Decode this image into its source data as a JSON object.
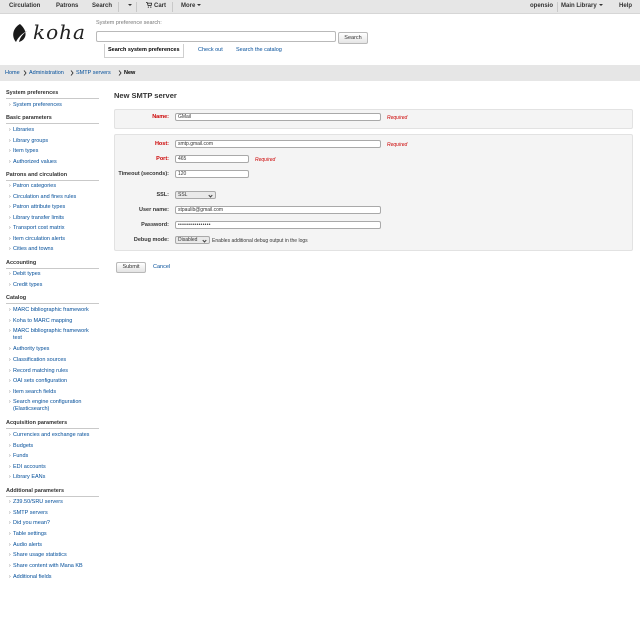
{
  "topnav": {
    "left": [
      "Circulation",
      "Patrons",
      "Search",
      "",
      "Cart",
      "More"
    ],
    "user": "opensio",
    "library": "Main Library",
    "help": "Help"
  },
  "header": {
    "logo_text": "koha",
    "search_label": "System preference search:",
    "search_value": "",
    "search_button": "Search",
    "tabs": [
      "Search system preferences",
      "Check out",
      "Search the catalog"
    ]
  },
  "breadcrumbs": [
    "Home",
    "Administration",
    "SMTP servers",
    "New"
  ],
  "sidebar": {
    "sections": [
      {
        "title": "System preferences",
        "items": [
          "System preferences"
        ]
      },
      {
        "title": "Basic parameters",
        "items": [
          "Libraries",
          "Library groups",
          "Item types",
          "Authorized values"
        ]
      },
      {
        "title": "Patrons and circulation",
        "items": [
          "Patron categories",
          "Circulation and fines rules",
          "Patron attribute types",
          "Library transfer limits",
          "Transport cost matrix",
          "Item circulation alerts",
          "Cities and towns"
        ]
      },
      {
        "title": "Accounting",
        "items": [
          "Debit types",
          "Credit types"
        ]
      },
      {
        "title": "Catalog",
        "items": [
          "MARC bibliographic framework",
          "Koha to MARC mapping",
          "MARC bibliographic framework test",
          "Authority types",
          "Classification sources",
          "Record matching rules",
          "OAI sets configuration",
          "Item search fields",
          "Search engine configuration (Elasticsearch)"
        ]
      },
      {
        "title": "Acquisition parameters",
        "items": [
          "Currencies and exchange rates",
          "Budgets",
          "Funds",
          "EDI accounts",
          "Library EANs"
        ]
      },
      {
        "title": "Additional parameters",
        "items": [
          "Z39.50/SRU servers",
          "SMTP servers",
          "Did you mean?",
          "Table settings",
          "Audio alerts",
          "Share usage statistics",
          "Share content with Mana KB",
          "Additional fields"
        ]
      }
    ]
  },
  "form": {
    "title": "New SMTP server",
    "name_label": "Name:",
    "name_value": "GMail",
    "required_text": "Required",
    "host_label": "Host:",
    "host_value": "smtp.gmail.com",
    "port_label": "Port:",
    "port_value": "465",
    "timeout_label": "Timeout (seconds):",
    "timeout_value": "120",
    "ssl_label": "SSL:",
    "ssl_value": "SSL",
    "user_label": "User name:",
    "user_value": "stpaulib@gmail.com",
    "password_label": "Password:",
    "password_value": "••••••••••••••••",
    "debug_label": "Debug mode:",
    "debug_value": "Disabled",
    "debug_hint": "Enables additional debug output in the logs",
    "submit": "Submit",
    "cancel": "Cancel"
  },
  "colors": {
    "link": "#004d99",
    "required": "#cc0000",
    "nav_bg": "#e6e6e6"
  }
}
